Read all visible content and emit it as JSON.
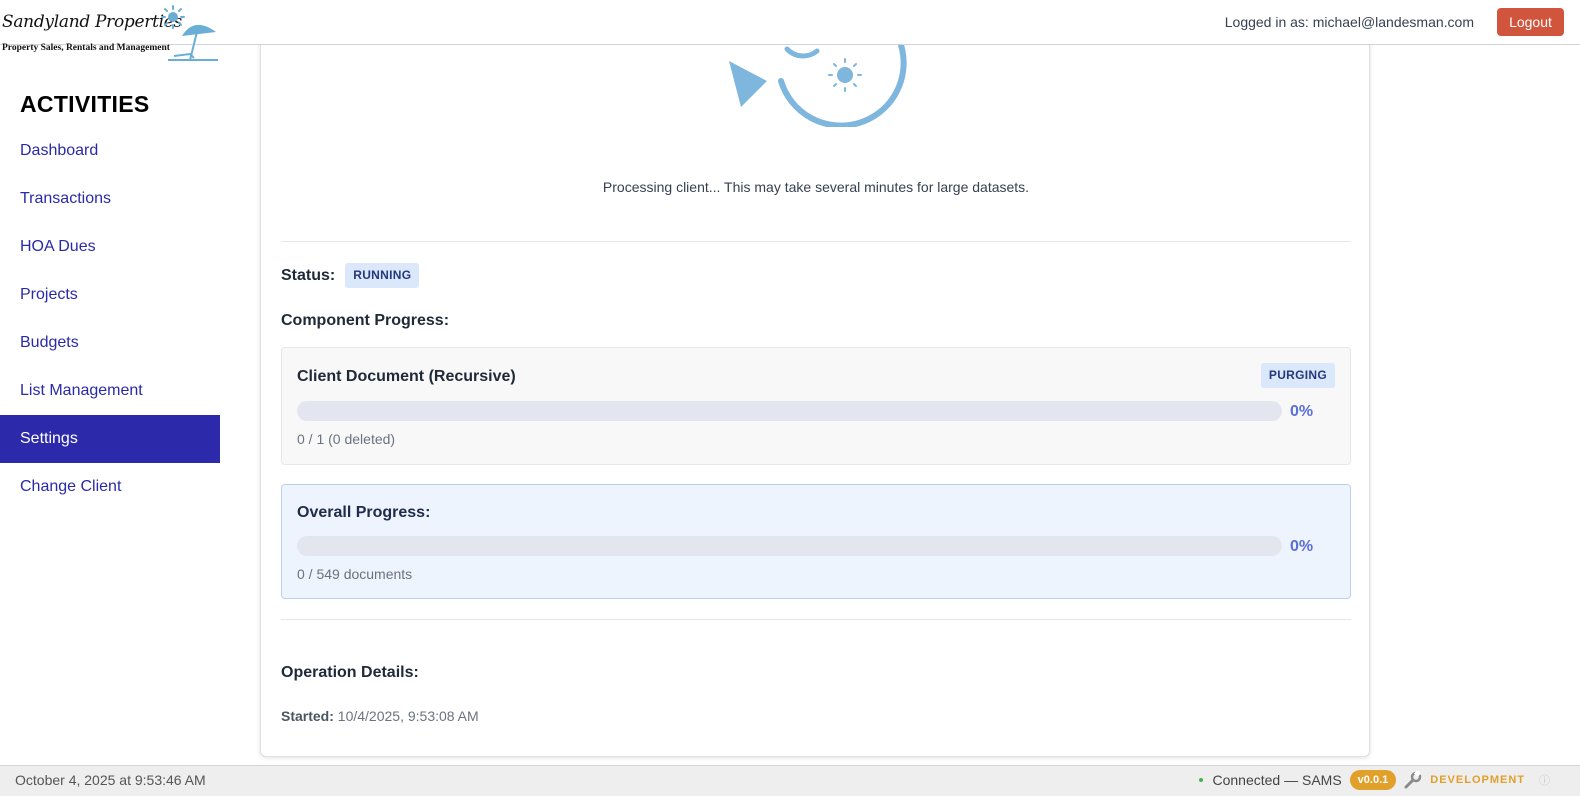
{
  "header": {
    "logo_name": "Sandyland Properties",
    "logo_tagline": "Property Sales, Rentals and Management",
    "logged_in_text": "Logged in as: michael@landesman.com",
    "logout_label": "Logout"
  },
  "sidebar": {
    "title": "ACTIVITIES",
    "items": [
      {
        "label": "Dashboard"
      },
      {
        "label": "Transactions"
      },
      {
        "label": "HOA Dues"
      },
      {
        "label": "Projects"
      },
      {
        "label": "Budgets"
      },
      {
        "label": "List Management"
      },
      {
        "label": "Settings",
        "active": true
      },
      {
        "label": "Change Client"
      }
    ]
  },
  "main": {
    "processing_message": "Processing client... This may take several minutes for large datasets.",
    "status_label": "Status:",
    "status_value": "RUNNING",
    "component_heading": "Component Progress:",
    "component": {
      "title": "Client Document (Recursive)",
      "badge": "PURGING",
      "progress_percent": 0,
      "percent_text": "0%",
      "detail": "0 / 1 (0 deleted)"
    },
    "overall": {
      "title": "Overall Progress:",
      "progress_percent": 0,
      "percent_text": "0%",
      "detail": "0 / 549 documents"
    },
    "operation_heading": "Operation Details:",
    "started_label": "Started:",
    "started_value": "10/4/2025, 9:53:08 AM"
  },
  "footer": {
    "date_text": "October 4, 2025 at 9:53:46 AM",
    "connection_text": "Connected — SAMS",
    "version": "v0.0.1",
    "environment": "DEVELOPMENT"
  },
  "colors": {
    "nav_active_bg": "#2c29ab",
    "nav_link": "#2a2aa8",
    "logout_bg": "#d0553c",
    "progress_accent": "#5a6fd8",
    "version_badge": "#e0a02a",
    "connected_dot": "#4caf50"
  },
  "icons": {
    "logo": "sun-and-beach-umbrella",
    "processing": "circular-arrow-with-sun",
    "footer_tool": "wrench-icon",
    "footer_info": "info-icon"
  }
}
